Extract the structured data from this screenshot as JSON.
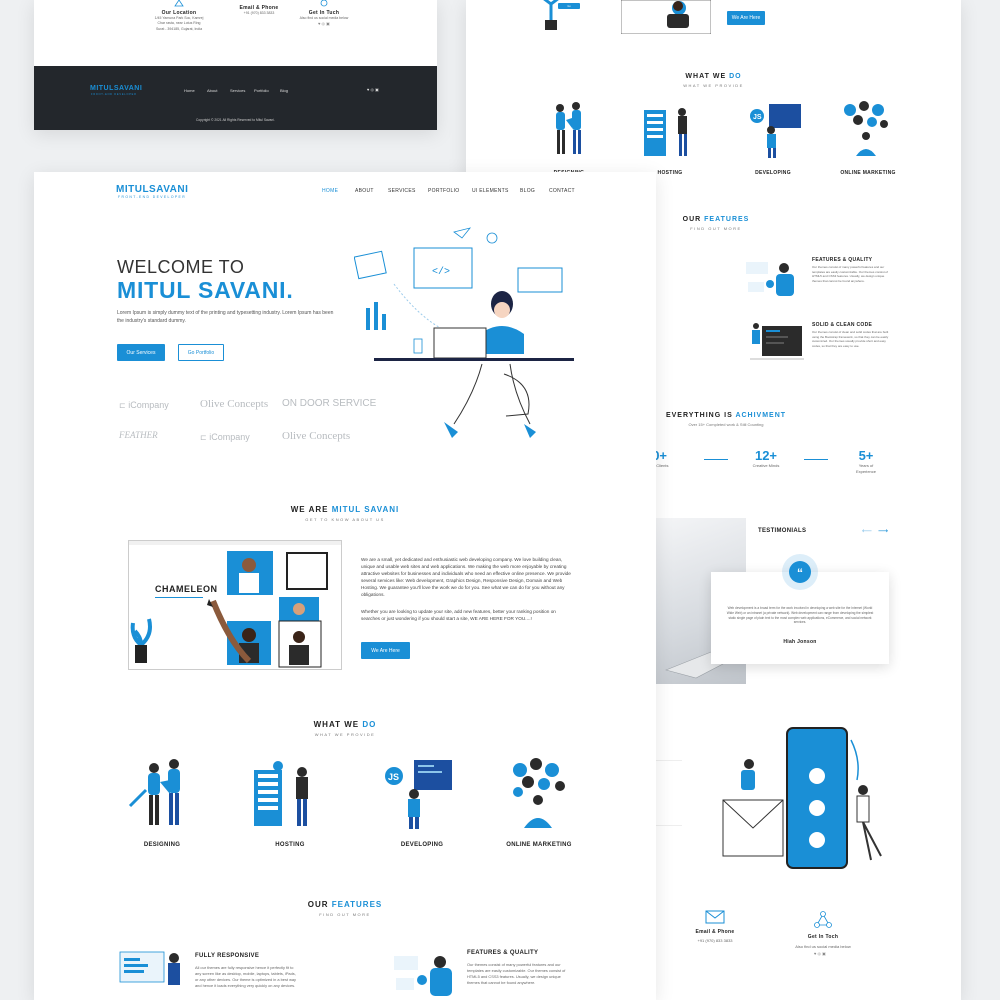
{
  "colors": {
    "accent": "#1a8fd6",
    "dark": "#23272c",
    "background": "#eef0f2"
  },
  "top_card": {
    "contacts": [
      {
        "icon": "location-icon",
        "title": "Our Location",
        "lines": [
          "1/45 Yamuna Park Soc, Kamrej",
          "Char rasta, near Lotus Ring",
          "Surat - 394185, Gujarat, India"
        ]
      },
      {
        "icon": "mail-icon",
        "title": "Email & Phone",
        "lines": [
          "+91 (970) 833 3833"
        ]
      },
      {
        "icon": "social-icon",
        "title": "Get In Tuch",
        "lines": [
          "Also find us social media below"
        ]
      }
    ],
    "footer": {
      "logo": "MITULSAVANI",
      "logo_sub": "FRONT-END DEVELOPER",
      "links": [
        "Home",
        "About",
        "Services",
        "Portfolio",
        "Blog"
      ],
      "copyright": "Copyright © 2021 All Rights Reserved to Mitul Savani."
    }
  },
  "main": {
    "logo": "MITULSAVANI",
    "logo_sub": "FRONT-END DEVELOPER",
    "nav": [
      "HOME",
      "ABOUT",
      "SERVICES",
      "PORTFOLIO",
      "UI ELEMENTS",
      "BLOG",
      "CONTACT"
    ],
    "hero": {
      "welcome": "WELCOME TO",
      "name": "MITUL SAVANI.",
      "text": "Lorem Ipsum is simply dummy text of the printing and typesetting industry. Lorem Ipsum has been the industry's standard dummy.",
      "btn_primary": "Our Services",
      "btn_secondary": "Go Portfolio"
    },
    "clients": [
      "iCompany",
      "Olive Concepts",
      "ON DOOR SERVICE",
      "FEATHER",
      "iCompany",
      "Olive Concepts"
    ],
    "about": {
      "title_a": "WE ARE ",
      "title_b": "MITUL SAVANI",
      "sub": "GET TO KNOW ABOUT US",
      "img_label": "CHAMELEON",
      "p1": "We are a small, yet dedicated and enthusiastic web developing company. We love building clean, unique and usable web sites and web applications. We making the web more enjoyable by creating attractive websites for businesses and individuals who need an effective online presence. We provide several services like: Web development, Graphics Design, Responsive Design, Domain and Web Hosting. We guarantee you'll love the work we do for you. See what we can do for you without any obligations.",
      "p2": "Whether you are looking to update your site, add new features, better your ranking position on searches or just wondering if you should start a site, WE ARE HERE FOR YOU....!",
      "btn": "We Are Here"
    },
    "services": {
      "title_a": "WHAT WE ",
      "title_b": "DO",
      "sub": "WHAT WE PROVIDE",
      "items": [
        "DESIGNING",
        "HOSTING",
        "DEVELOPING",
        "ONLINE MARKETING"
      ]
    },
    "features": {
      "title_a": "OUR ",
      "title_b": "FEATURES",
      "sub": "FIND OUT MORE",
      "items": [
        {
          "title": "FULLY RESPONSIVE",
          "text": "All our themes are fully responsive hence it perfectly fit to any screen like as desktop, mobile, laptops, tablets, iPads, or any other devices. Our theme is optimized in a best way and hence it loads everything very quickly on any devices."
        },
        {
          "title": "FEATURES & QUALITY",
          "text": "Our themes consist of many powerful features and our templates are easily customizable. Our themes consist of HTML5 and CSS3 features. Usually, we design unique themes that cannot be found anywhere."
        }
      ]
    }
  },
  "right_card": {
    "top_btn": "We Are Here",
    "services": {
      "title_a": "WHAT WE ",
      "title_b": "DO",
      "sub": "WHAT WE PROVIDE",
      "items": [
        "DESIGNING",
        "HOSTING",
        "DEVELOPING",
        "ONLINE MARKETING"
      ]
    },
    "features": {
      "title_a": "OUR ",
      "title_b": "FEATURES",
      "sub": "FIND OUT MORE",
      "items": [
        {
          "title": "FEATURES & QUALITY",
          "text": "Our themes consist of many powerful features and our templates are easily customizable. Our themes consist of HTML5 and CSS3 features. Usually, we design unique themes that cannot be found anywhere."
        },
        {
          "title": "SOLID & CLEAN CODE",
          "text": "Our themes consist of clean and solid codes that are built using the Bootstrap framework, so that they can be easily customized. Our themes usually provide short and easy codes, so that they are easy to use."
        }
      ]
    },
    "achievement": {
      "title_a": "EVERYTHING IS ",
      "title_b": "ACHIVMENT",
      "sub": "Over 15+ Completed work & Still Counting",
      "stats": [
        {
          "value": "50+",
          "label": "Happy Clients"
        },
        {
          "value": "12+",
          "label": "Creative Minds"
        },
        {
          "value": "5+",
          "label": "Years of Experience"
        }
      ]
    },
    "testimonial": {
      "title": "TESTIMONIALS",
      "text": "Web development is a broad term for the work involved in developing a web site for the Internet (World Wide Web) or an intranet (a private network). Web development can range from developing the simplest static single page of plain text to the most complex web applications, eCommerce, and social network services.",
      "author": "Hiah Jonson"
    },
    "contacts": [
      {
        "title": "Email & Phone",
        "line": "+91 (970) 833 3833"
      },
      {
        "title": "Get In Toch",
        "line": "Also find us social media below"
      }
    ]
  }
}
